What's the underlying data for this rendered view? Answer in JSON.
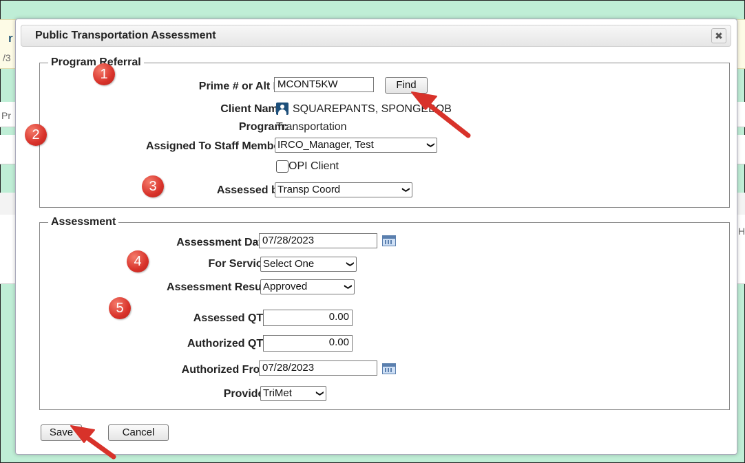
{
  "window_title": "Public Transportation Assessment",
  "close_glyph": "✖",
  "background": {
    "heading_fragment": "r",
    "date_fragment": "/3",
    "tab_fragment": "Pr",
    "right_fragment": "H"
  },
  "program_referral": {
    "legend": "Program Referral",
    "prime_label": "Prime # or Alt ID:",
    "prime_value": "MCONT5KW",
    "find_button": "Find",
    "client_name_label": "Client Name:",
    "client_name_value": "SQUAREPANTS, SPONGEBOB",
    "program_label": "Program:",
    "program_value": "Transportation",
    "assigned_label": "Assigned To Staff Member:",
    "assigned_value": "IRCO_Manager, Test",
    "opi_label": "OPI Client",
    "assessed_by_label": "Assessed by:",
    "assessed_by_value": "Transp Coord"
  },
  "assessment": {
    "legend": "Assessment",
    "date_label": "Assessment Date:",
    "date_value": "07/28/2023",
    "service_label": "For Service:",
    "service_value": "Select One",
    "result_label": "Assessment Result:",
    "result_value": "Approved",
    "assessed_qty_label": "Assessed QTY:",
    "assessed_qty_value": "0.00",
    "authorized_qty_label": "Authorized QTY:",
    "authorized_qty_value": "0.00",
    "authorized_from_label": "Authorized From:",
    "authorized_from_value": "07/28/2023",
    "provider_label": "Provider:",
    "provider_value": "TriMet"
  },
  "actions": {
    "save": "Save",
    "cancel": "Cancel"
  },
  "markers": [
    "1",
    "2",
    "3",
    "4",
    "5"
  ],
  "chevron_glyph": "❯",
  "colors": {
    "marker": "#d8322a",
    "arrow": "#d8322a",
    "background": "#bfeed6",
    "title_bar": "#e6e6e6"
  }
}
